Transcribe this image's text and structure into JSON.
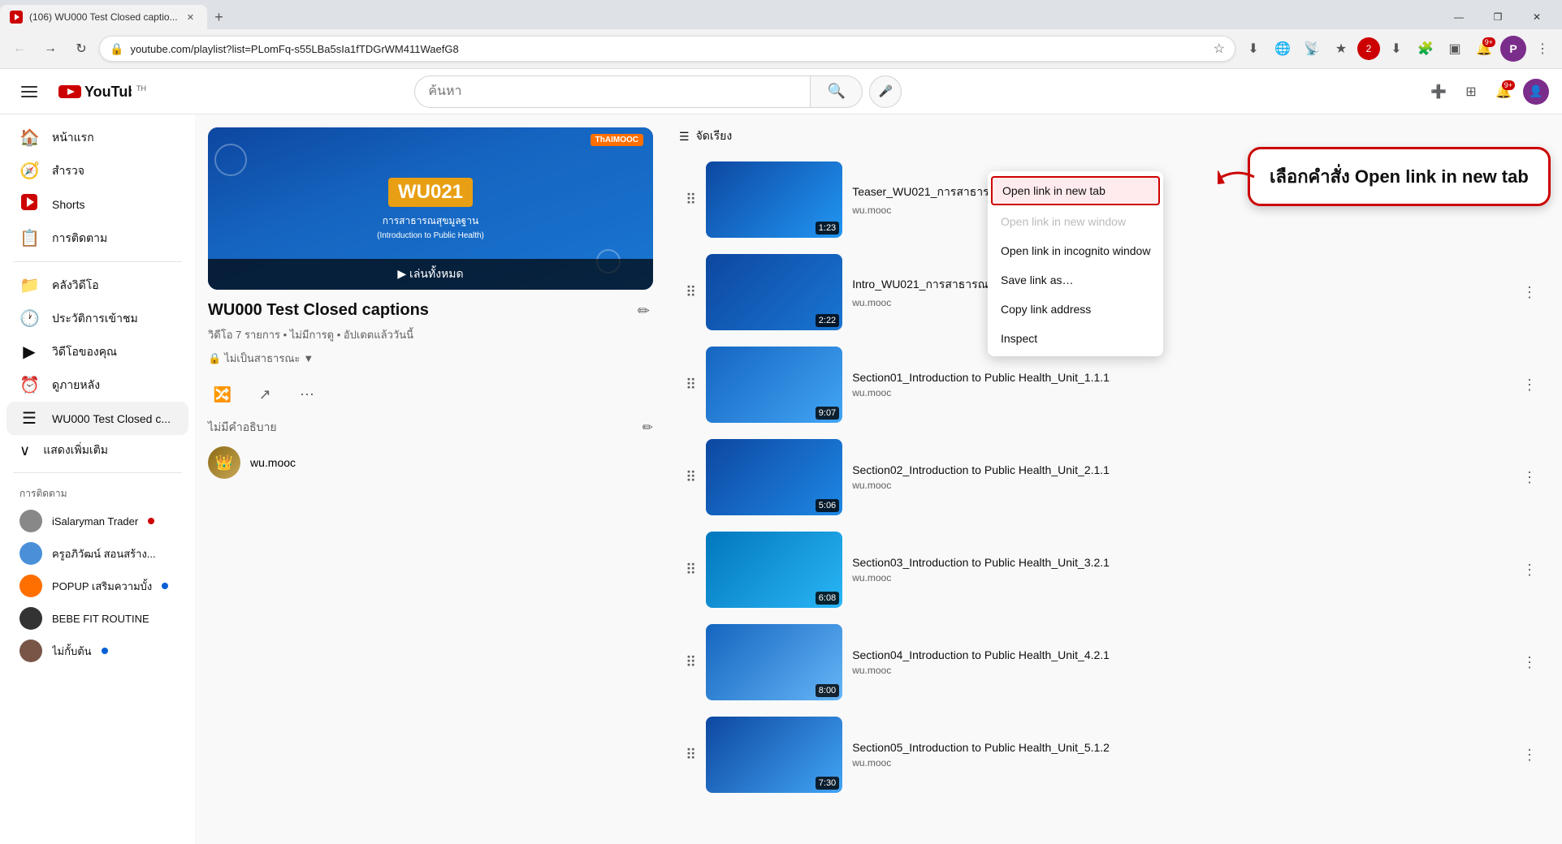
{
  "browser": {
    "tab_title": "(106) WU000 Test Closed captio...",
    "url": "youtube.com/playlist?list=PLomFq-s55LBa5sIa1fTDGrWM411WaefG8",
    "new_tab_label": "+",
    "window_controls": {
      "minimize": "—",
      "maximize": "❐",
      "close": "✕"
    },
    "nav": {
      "back": "←",
      "forward": "→",
      "refresh": "↻"
    }
  },
  "youtube": {
    "search_placeholder": "ค้นหา",
    "logo_text": "YouTube",
    "logo_country": "TH"
  },
  "sidebar": {
    "items": [
      {
        "id": "home",
        "label": "หน้าแรก",
        "icon": "🏠"
      },
      {
        "id": "explore",
        "label": "สำรวจ",
        "icon": "🧭"
      },
      {
        "id": "shorts",
        "label": "Shorts",
        "icon": "▶"
      },
      {
        "id": "subscriptions",
        "label": "การติดตาม",
        "icon": "📋"
      },
      {
        "id": "library",
        "label": "คลังวิดีโอ",
        "icon": "📁"
      },
      {
        "id": "history",
        "label": "ประวัติการเข้าชม",
        "icon": "🕐"
      },
      {
        "id": "your-videos",
        "label": "วิดีโอของคุณ",
        "icon": "▶"
      },
      {
        "id": "watch-later",
        "label": "ดูภายหลัง",
        "icon": "⏰"
      },
      {
        "id": "playlist",
        "label": "WU000 Test Closed c...",
        "icon": "☰",
        "active": true
      }
    ],
    "show_more": "แสดงเพิ่มเติม",
    "section_subscriptions": "การติดตาม",
    "channels": [
      {
        "name": "iSalaryman Trader",
        "live": true
      },
      {
        "name": "ครูอภิวัฒน์ สอนสร้าง...",
        "live": false
      },
      {
        "name": "POPUP เสริมความบั้ง",
        "dot": true
      },
      {
        "name": "BEBE FIT ROUTINE",
        "dot": false
      },
      {
        "name": "ไม่กั้บต้น",
        "dot": true
      }
    ]
  },
  "playlist": {
    "title": "WU000 Test Closed captions",
    "meta": "วิดีโอ 7 รายการ • ไม่มีการดู • อัปเดตแล้ววันนี้",
    "privacy": "ไม่เป็นสาธารณะ",
    "privacy_icon": "▼",
    "description": "ไม่มีคำอธิบาย",
    "channel": "wu.mooc",
    "play_all": "เล่นทั้งหมด",
    "edit_icon": "✏",
    "actions": {
      "shuffle": "🔀",
      "share": "↗",
      "more": "⋯"
    }
  },
  "video_list": {
    "sort_label": "จัดเรียง",
    "sort_icon": "☰",
    "videos": [
      {
        "id": 1,
        "title": "Teaser_WU021_การสาธารณสุขมูลฐาน in Public_Health",
        "channel": "wu.mooc",
        "duration": "1:23",
        "position": 1
      },
      {
        "id": 2,
        "title": "Intro_WU021_การสาธารณสุขมูลฐาน in Public_Health",
        "channel": "wu.mooc",
        "duration": "2:22",
        "position": 2
      },
      {
        "id": 3,
        "title": "Section01_Introduction to Public Health_Unit_1.1.1",
        "channel": "wu.mooc",
        "duration": "9:07",
        "position": 3
      },
      {
        "id": 4,
        "title": "Section02_Introduction to Public Health_Unit_2.1.1",
        "channel": "wu.mooc",
        "duration": "5:06",
        "position": 4
      },
      {
        "id": 5,
        "title": "Section03_Introduction to Public Health_Unit_3.2.1",
        "channel": "wu.mooc",
        "duration": "6:08",
        "position": 5
      },
      {
        "id": 6,
        "title": "Section04_Introduction to Public Health_Unit_4.2.1",
        "channel": "wu.mooc",
        "duration": "8:00",
        "position": 6
      },
      {
        "id": 7,
        "title": "Section05_Introduction to Public Health_Unit_5.1.2",
        "channel": "wu.mooc",
        "duration": "7:30",
        "position": 7
      }
    ]
  },
  "context_menu": {
    "items": [
      {
        "label": "Open link in new tab",
        "highlighted": true
      },
      {
        "label": "Open link in new window",
        "dimmed": false
      },
      {
        "label": "Open link in incognito window",
        "dimmed": false
      },
      {
        "label": "Save link as…",
        "dimmed": false
      },
      {
        "label": "Copy link address",
        "dimmed": false
      },
      {
        "label": "Inspect",
        "dimmed": false
      }
    ]
  },
  "annotation": {
    "text": "เลือกคำสั่ง Open link in new tab"
  }
}
